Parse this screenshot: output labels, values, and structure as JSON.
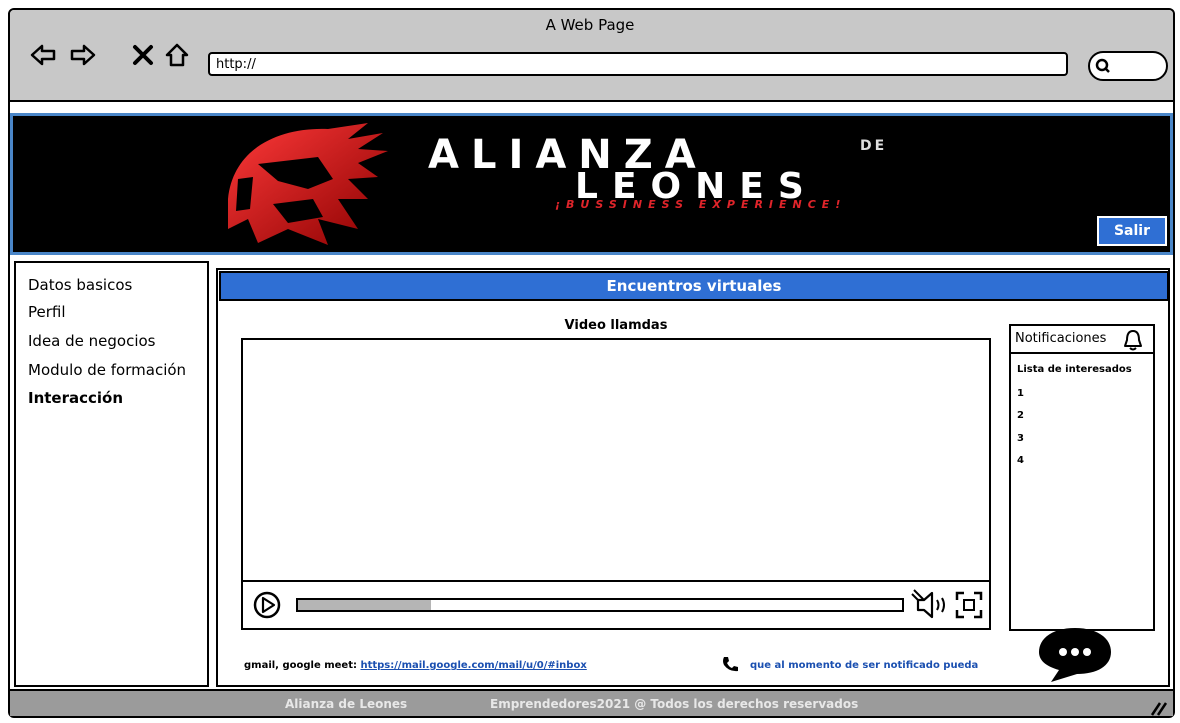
{
  "window": {
    "title": "A Web Page",
    "url": "http://"
  },
  "banner": {
    "brand_line1": "ALIANZA",
    "brand_de": "DE",
    "brand_line2": "LEONES",
    "tagline": "¡BUSSINESS EXPERIENCE!",
    "logout_label": "Salir"
  },
  "sidebar": {
    "items": [
      {
        "label": "Datos basicos"
      },
      {
        "label": "Perfil"
      },
      {
        "label": "Idea de negocios"
      },
      {
        "label": "Modulo de formación"
      },
      {
        "label": "Interacción"
      }
    ]
  },
  "main": {
    "header": "Encuentros virtuales",
    "video_title": "Video llamdas",
    "video_progress": 0.22
  },
  "notifications": {
    "title": "Notificaciones",
    "list_title": "Lista de interesados",
    "items": [
      "1",
      "2",
      "3",
      "4"
    ]
  },
  "footer": {
    "label": "gmail, google meet:",
    "link": "https://mail.google.com/mail/u/0/#inbox",
    "phone_text": "que al momento de ser notificado pueda"
  },
  "bottom_bar": {
    "left": "Alianza de Leones",
    "right": "Emprendedores2021 @  Todos los derechos reservados"
  },
  "colors": {
    "accent": "#2f6fd4",
    "banner_border": "#4a86c8",
    "brand_red": "#e0242a"
  }
}
